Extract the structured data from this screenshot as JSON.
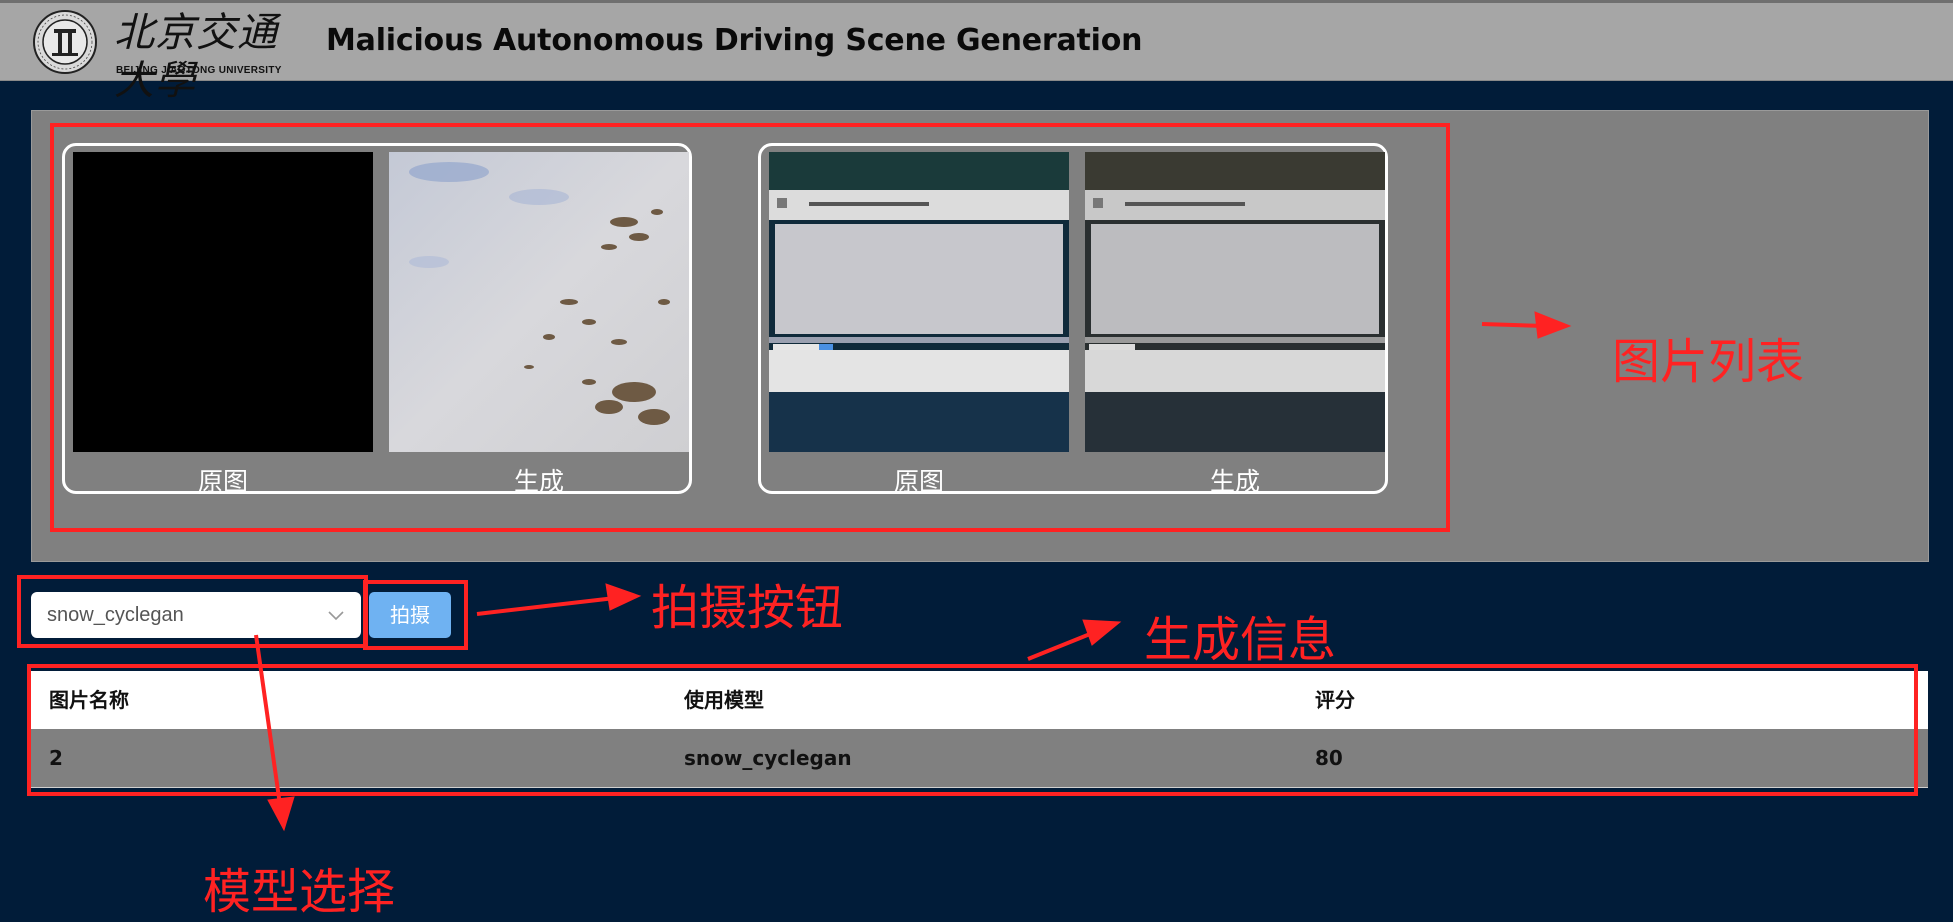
{
  "header": {
    "logo_cn": "北京交通大學",
    "logo_en": "BEIJING JIAOTONG UNIVERSITY",
    "title": "Malicious Autonomous Driving Scene Generation"
  },
  "gallery": {
    "pairs": [
      {
        "original_label": "原图",
        "generated_label": "生成"
      },
      {
        "original_label": "原图",
        "generated_label": "生成"
      }
    ]
  },
  "controls": {
    "model_select_value": "snow_cyclegan",
    "shoot_button_label": "拍摄"
  },
  "table": {
    "headers": [
      "图片名称",
      "使用模型",
      "评分"
    ],
    "rows": [
      [
        "2",
        "snow_cyclegan",
        "80"
      ]
    ]
  },
  "annotations": {
    "image_list": "图片列表",
    "shoot_button": "拍摄按钮",
    "generation_info": "生成信息",
    "model_select": "模型选择",
    "color": "#ff2222"
  },
  "icons": [
    "university-seal-icon",
    "chevron-down-icon"
  ]
}
